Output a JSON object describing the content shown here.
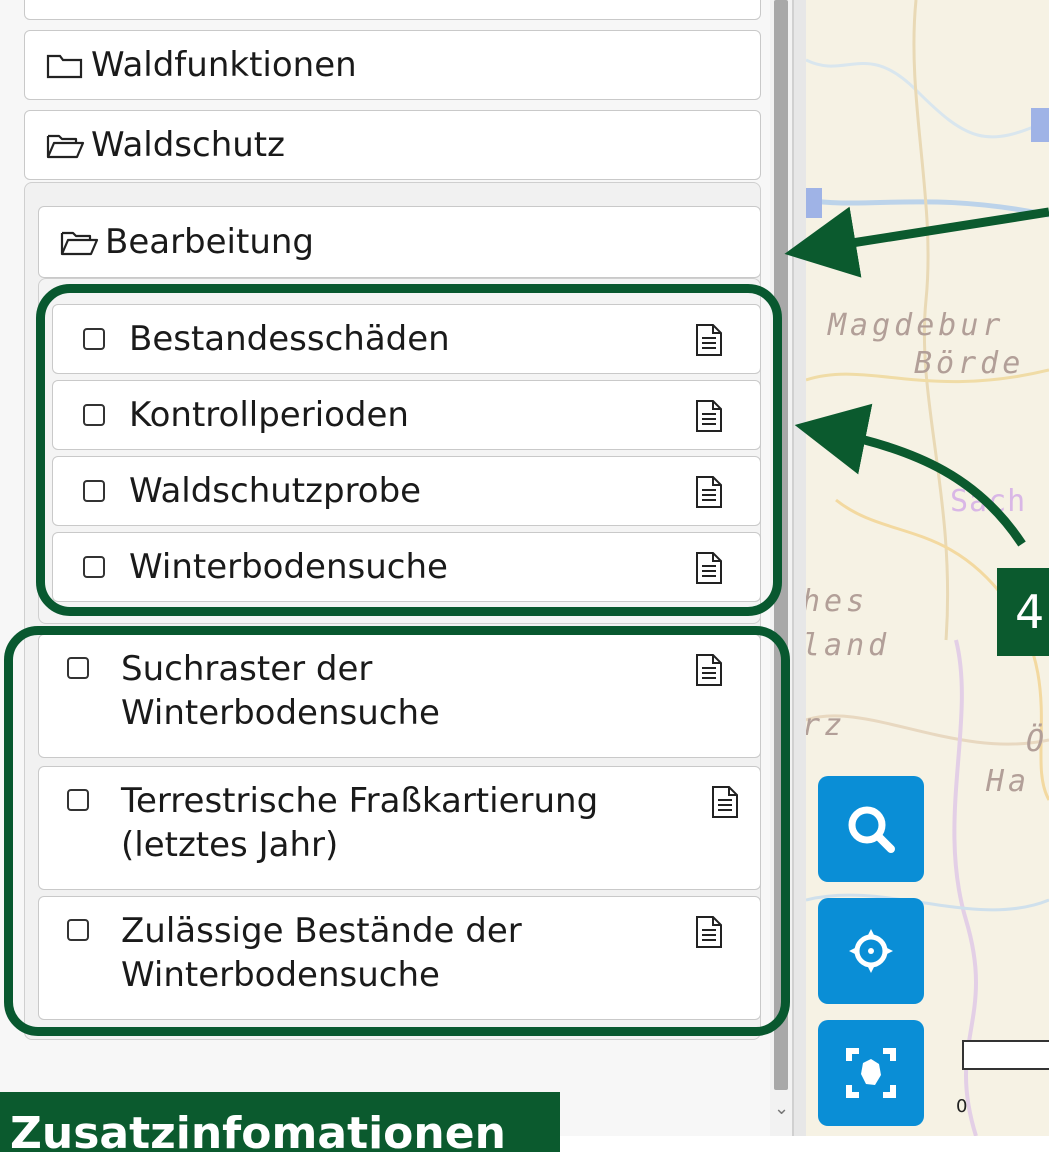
{
  "tree": {
    "waldfunktionen": "Waldfunktionen",
    "waldschutz": "Waldschutz",
    "bearbeitung": "Bearbeitung",
    "bearbeitung_layers": [
      "Bestandesschäden",
      "Kontrollperioden",
      "Waldschutzprobe",
      "Winterbodensuche"
    ],
    "waldschutz_layers": [
      [
        "Suchraster der",
        "Winterbodensuche"
      ],
      [
        "Terrestrische Fraßkartierung",
        "(letztes Jahr)"
      ],
      [
        "Zulässige Bestände der",
        "Winterbodensuche"
      ]
    ]
  },
  "map": {
    "labels": [
      "Magdebur",
      "Börde",
      "Sach",
      "hes",
      "land",
      "rz",
      "Ö",
      "Ha"
    ],
    "scale_zero": "0",
    "buttons": [
      "search-icon",
      "locate-icon",
      "full-extent-icon"
    ]
  },
  "annotations": {
    "badge": "4",
    "caption": "Zusatzinfomationen"
  },
  "colors": {
    "highlight": "#08582f",
    "map_button": "#0a8ed6"
  }
}
